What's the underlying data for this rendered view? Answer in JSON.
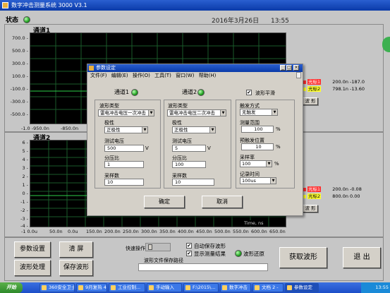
{
  "window": {
    "title": "数字冲击测量系统 3000 V3.1"
  },
  "status": {
    "label": "状态",
    "date": "2016年3月26日",
    "time": "13:55"
  },
  "channel1": {
    "title": "通道1",
    "y_ticks": [
      "700.0 -",
      "500.0 -",
      "300.0 -",
      "100.0 -",
      "-100.0 -",
      "-300.0 -",
      "-500.0 -"
    ],
    "x_ticks": [
      "-1.0 -950.0n",
      "-850.0n"
    ],
    "legend": [
      {
        "name": "光标1",
        "value": "200.0n -187.0",
        "color": "#ff3030"
      },
      {
        "name": "光标2",
        "value": "798.1n -13.60",
        "color": "#ffff30"
      }
    ],
    "side_button": "波  形"
  },
  "channel2": {
    "title": "通道2",
    "y_ticks": [
      "6 -",
      "5 -",
      "4 -",
      "3 -",
      "2 -",
      "1 -",
      "0 -",
      "-1 -",
      "-2 -",
      "-3 -",
      "-4 -"
    ],
    "x_ticks": [
      "-1 0.0u",
      "50.0n",
      "0.0u",
      "150.0n",
      "200.0n",
      "250.0n",
      "300.0n",
      "350.0n",
      "400.0n",
      "450.0n",
      "500.0n",
      "550.0n",
      "600.0n",
      "650.0n",
      "700.0n"
    ],
    "time_label": "Time, ns",
    "legend": [
      {
        "name": "光标1",
        "value": "200.0n -0.08",
        "color": "#ff3030"
      },
      {
        "name": "光标2",
        "value": "800.0n 0.00",
        "color": "#ffff30"
      }
    ],
    "side_button": "波  形"
  },
  "bottom": {
    "buttons": [
      "参数设置",
      "清  屏",
      "波形处理",
      "保存波形"
    ],
    "sensitivity_label": "快速操作",
    "auto_save_label": "自动保存波形",
    "show_result_label": "显示测量结果",
    "wave_restore_label": "波形还原",
    "file_path_label": "波形文件保存路径",
    "file_path_value": "",
    "acquire_button": "获取波形",
    "exit_button": "退  出"
  },
  "taskbar": {
    "start": "开始",
    "tasks": [
      "360安全卫士",
      "9月复热 4",
      "工业控制...",
      "手动输入",
      "F:\\2015\\...",
      "数字冲击",
      "文档 2 -",
      "参数设定"
    ],
    "clock": "13:55"
  },
  "dialog": {
    "title": "参数设定",
    "menu": [
      "文件(F)",
      "编辑(E)",
      "操作(O)",
      "工具(T)",
      "窗口(W)",
      "帮助(H)"
    ],
    "ch1": {
      "title": "通道1",
      "type_label": "波形类型",
      "type_value": "雷电冲击电压一次冲击",
      "polarity_label": "极性",
      "polarity_value": "正极性",
      "voltage_label": "测试电压",
      "voltage_value": "500",
      "voltage_unit": "V",
      "div_label": "分压比",
      "div_value": "1",
      "count_label": "采样数",
      "count_value": "10"
    },
    "ch2": {
      "title": "通道2",
      "type_label": "波形类型",
      "type_value": "雷电冲击电压二次冲击",
      "polarity_label": "极性",
      "polarity_value": "正极性",
      "voltage_label": "测试电压",
      "voltage_value": "5",
      "voltage_unit": "V",
      "div_label": "分压比",
      "div_value": "100",
      "count_label": "采样数",
      "count_value": "10"
    },
    "right": {
      "flat_label": "波形平滑",
      "trigger_label": "触发方式",
      "trigger_value": "无触发",
      "range_label": "测量范围",
      "range_value": "100",
      "range_unit": "%",
      "pretrig_label": "预触发位置",
      "pretrig_value": "10",
      "pretrig_unit": "%",
      "rate_label": "采样率",
      "rate_value": "100",
      "rate_unit": "%",
      "length_label": "记录时间",
      "length_value": "100us"
    },
    "ok_button": "确定",
    "cancel_button": "取消"
  },
  "colors": {
    "plot_bg": "#000000",
    "grid": "#1a5a2a",
    "led": "#20a020",
    "title_blue": "#0a3aa8"
  }
}
